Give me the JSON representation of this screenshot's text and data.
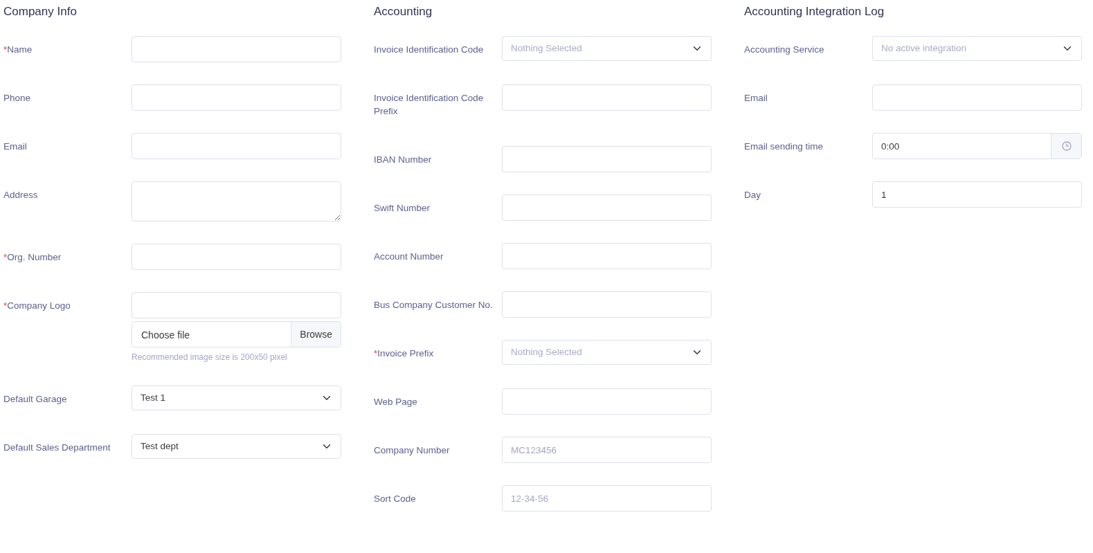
{
  "sections": [
    {
      "title": "Company Info",
      "fields": [
        {
          "kind": "text",
          "label": "Name",
          "required_mark": "*"
        },
        {
          "kind": "text",
          "label": "Phone"
        },
        {
          "kind": "text",
          "label": "Email"
        },
        {
          "kind": "textarea",
          "label": "Address"
        },
        {
          "kind": "text",
          "label": "Org. Number",
          "required_mark": "*"
        },
        {
          "kind": "file",
          "label": "Company Logo",
          "required_mark": "*",
          "file_text": "Choose file",
          "button": "Browse",
          "help": "Recommended image size is 200x50 pixel"
        },
        {
          "kind": "select",
          "label": "Default Garage",
          "value": "Test 1"
        },
        {
          "kind": "select",
          "label": "Default Sales Department",
          "value": "Test dept"
        }
      ]
    },
    {
      "title": "Accounting",
      "fields": [
        {
          "kind": "select",
          "label": "Invoice Identification Code",
          "placeholder": "Nothing Selected"
        },
        {
          "kind": "text",
          "label": "Invoice Identification Code Prefix"
        },
        {
          "kind": "text",
          "label": "IBAN Number"
        },
        {
          "kind": "text",
          "label": "Swift Number"
        },
        {
          "kind": "text",
          "label": "Account Number"
        },
        {
          "kind": "text",
          "label": "Bus Company Customer No."
        },
        {
          "kind": "select",
          "label": "Invoice Prefix",
          "required_mark": "*",
          "placeholder": "Nothing Selected"
        },
        {
          "kind": "text",
          "label": "Web Page"
        },
        {
          "kind": "text",
          "label": "Company Number",
          "placeholder": "MC123456"
        },
        {
          "kind": "text",
          "label": "Sort Code",
          "placeholder": "12-34-56"
        }
      ]
    },
    {
      "title": "Accounting Integration Log",
      "fields": [
        {
          "kind": "select",
          "label": "Accounting Service",
          "placeholder": "No active integration"
        },
        {
          "kind": "text",
          "label": "Email"
        },
        {
          "kind": "time",
          "label": "Email sending time",
          "value": "0:00"
        },
        {
          "kind": "text",
          "label": "Day",
          "value": "1"
        }
      ]
    }
  ]
}
